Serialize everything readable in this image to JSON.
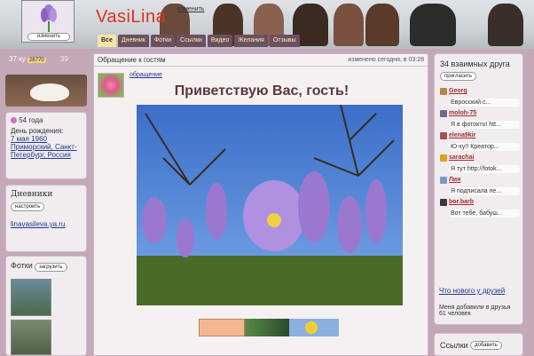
{
  "header": {
    "avatar_change": "изменить",
    "site_name": "VasiLina",
    "change_link": "изменить",
    "tabs": [
      "Все",
      "Дневник",
      "Фотки",
      "Ссылки",
      "Видео",
      "Желания",
      "Отзывы"
    ]
  },
  "left": {
    "stat_left": "37 ку",
    "stat_count": "28770",
    "stat_right": "39",
    "age": "54 года",
    "birthday_label": "День рождения:",
    "birthday_date": "7 мая 1960",
    "birthday_city": "Приморский, Санкт-Петербург, Россия",
    "diaries_title": "Дневники",
    "configure_btn": "настроить",
    "diary_link": "linavasileva.ya.ru",
    "photos_title": "Фотки",
    "upload_btn": "загрузить"
  },
  "main": {
    "section_title": "Обращение к гостям",
    "edited": "изменено сегодня, в 03:28",
    "tag": "обращение",
    "greeting": "Приветствую Вас, гость!"
  },
  "right": {
    "friends_title": "34 взаимных друга",
    "invite_btn": "пригласить",
    "friends": [
      {
        "name": "Georg",
        "msg": "Евросский с...",
        "color": "#b08848"
      },
      {
        "name": "moloh-75",
        "msg": "Я в фотокто! htt...",
        "color": "#6a6a8a"
      },
      {
        "name": "elena9kir",
        "msg": "Ю-ху!! Креатор...",
        "color": "#a05050"
      },
      {
        "name": "sarachai",
        "msg": "Я тут http://fotok...",
        "color": "#e0a020"
      },
      {
        "name": "Лия",
        "msg": "Я подписала пе...",
        "color": "#7a9ac0"
      },
      {
        "name": "bor.barb",
        "msg": "Вот тебе, бабуш...",
        "color": "#403838"
      }
    ],
    "whats_new": "Что нового у друзей",
    "added_me": "Меня добавили в друзья 61 человек",
    "links_title": "Ссылки",
    "add_btn": "добавить"
  },
  "colors": {
    "accent_red": "#e23020",
    "tab_bg": "#6d4f62",
    "tab_active": "#f4e6a6",
    "page_bg": "#c4a8b8"
  }
}
